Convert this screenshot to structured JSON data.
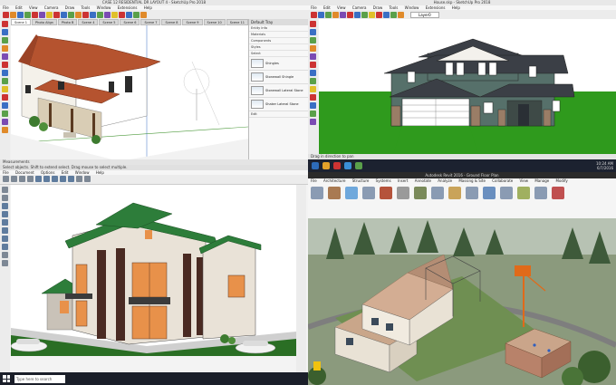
{
  "q1": {
    "title": "CASE 12 RESIDENTIAL DR LAYOUT 4 - SketchUp Pro 2018",
    "menu": [
      "File",
      "Edit",
      "View",
      "Camera",
      "Draw",
      "Tools",
      "Window",
      "Extensions",
      "Help"
    ],
    "scene_tabs": [
      "Scene 1",
      "Photo Align",
      "Photo B",
      "Scene 4",
      "Scene 5",
      "Scene 6",
      "Scene 7",
      "Scene 8",
      "Scene 9",
      "Scene 10",
      "Scene 11"
    ],
    "tray": {
      "header": "Default Tray",
      "rows": [
        "Entity Info",
        "Materials",
        "Components",
        "Styles"
      ],
      "styles": [
        "Shingles",
        "Stonewall Shingle",
        "Stonewall Lateral Stone",
        "Shaker Lateral Stone"
      ],
      "edit_label": "Edit",
      "select_label": "Select"
    },
    "status": "Select objects. Shift to extend select. Drag mouse to select multiple.",
    "measurements_label": "Measurements"
  },
  "q2": {
    "title": "House.skp - SketchUp Pro 2018",
    "menu": [
      "File",
      "Edit",
      "View",
      "Camera",
      "Draw",
      "Tools",
      "Window",
      "Extensions",
      "Help"
    ],
    "layer_label": "Layer0",
    "status": "Drag in direction to pan"
  },
  "q3": {
    "prompt": "Select objects. Shift to extend select. Drag mouse to select multiple.",
    "menu": [
      "File",
      "Document",
      "Options",
      "Edit",
      "Window",
      "Help"
    ],
    "taskbar_search": "Type here to search"
  },
  "q4": {
    "title": "Autodesk Revit 2016 - Ground Floor Plan",
    "ribbon_tabs": [
      "File",
      "Architecture",
      "Structure",
      "Systems",
      "Insert",
      "Annotate",
      "Analyze",
      "Massing & Site",
      "Collaborate",
      "View",
      "Manage",
      "Modify"
    ],
    "clock_time": "10:24 AM",
    "clock_date": "6/7/2016"
  }
}
